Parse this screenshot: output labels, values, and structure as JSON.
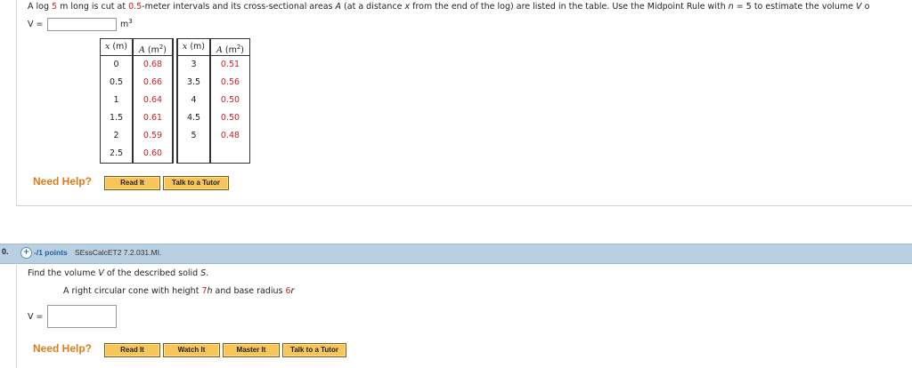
{
  "q1": {
    "text_a": "A log ",
    "length": "5",
    "text_b": " m long is cut at ",
    "interval": "0.5",
    "text_c": "-meter intervals and its cross-sectional areas ",
    "var_A": "A",
    "text_d": " (at a distance ",
    "var_x": "x",
    "text_e": " from the end of the log) are listed in the table. Use the Midpoint Rule with ",
    "var_n": "n",
    "text_f": " = ",
    "n_value": "5",
    "text_g": " to estimate the volume ",
    "var_V": "V",
    "text_h": " o",
    "v_label": "V =",
    "v_value": "",
    "unit": "m",
    "unit_exp": "3",
    "table": {
      "headers": {
        "x_var": "x",
        "x_unit": " (m)",
        "a_var": "A",
        "a_unit": " (m",
        "a_exp": "2",
        "a_close": ")"
      },
      "x_left": [
        "0",
        "0.5",
        "1",
        "1.5",
        "2",
        "2.5"
      ],
      "a_left": [
        "0.68",
        "0.66",
        "0.64",
        "0.61",
        "0.59",
        "0.60"
      ],
      "x_right": [
        "3",
        "3.5",
        "4",
        "4.5",
        "5"
      ],
      "a_right": [
        "0.51",
        "0.56",
        "0.50",
        "0.50",
        "0.48"
      ]
    },
    "need_help": "Need Help?",
    "buttons": {
      "read": "Read It",
      "tutor": "Talk to a Tutor"
    }
  },
  "q2": {
    "number": "0.",
    "plus": "+",
    "points": "-/1 points",
    "reference": "SEssCalcET2 7.2.031.MI.",
    "prompt_a": "Find the volume ",
    "var_V": "V",
    "prompt_b": " of the described solid ",
    "var_S": "S",
    "prompt_c": ".",
    "desc_a": "A right circular cone with height ",
    "height": "7",
    "var_h": "h",
    "desc_b": " and base radius ",
    "radius": "6",
    "var_r": "r",
    "v_label": "V =",
    "v_value": "",
    "need_help": "Need Help?",
    "buttons": {
      "read": "Read It",
      "watch": "Watch It",
      "master": "Master It",
      "tutor": "Talk to a Tutor"
    }
  },
  "colors": {
    "accent_red": "#d0202a",
    "need_help_orange": "#e07b1a",
    "button_gold": "#f6c65a",
    "question_bar": "#b9cfe2",
    "points_blue": "#1e5fa8"
  }
}
